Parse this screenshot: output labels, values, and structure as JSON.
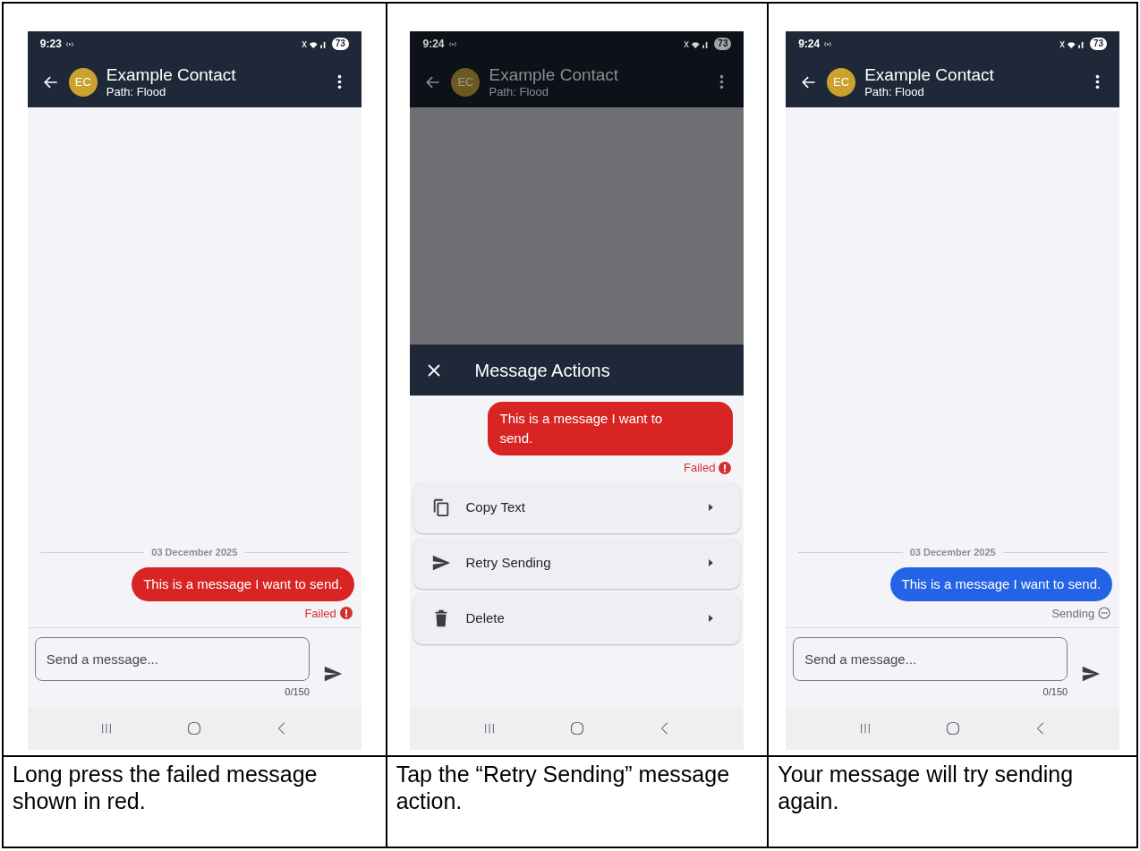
{
  "panels": [
    {
      "screen": {
        "kind": "chat",
        "dimmed": false,
        "time": "9:23",
        "battery": "73",
        "contact": {
          "initials": "EC",
          "name": "Example Contact",
          "path": "Path: Flood"
        },
        "date": "03 December 2025",
        "message": {
          "text": "This is a message I want to send.",
          "kind": "failed",
          "status_label": "Failed"
        },
        "input": {
          "placeholder": "Send a message...",
          "counter": "0/150"
        }
      },
      "caption": "Long press the failed message shown in red."
    },
    {
      "screen": {
        "kind": "actions",
        "dimmed": true,
        "time": "9:24",
        "battery": "73",
        "contact": {
          "initials": "EC",
          "name": "Example Contact",
          "path": "Path: Flood"
        },
        "sheet_title": "Message Actions",
        "message": {
          "text": "This is a message I want to send.",
          "kind": "failed",
          "status_label": "Failed"
        },
        "actions": [
          {
            "kind": "copy",
            "label": "Copy Text"
          },
          {
            "kind": "send",
            "label": "Retry Sending"
          },
          {
            "kind": "trash",
            "label": "Delete"
          }
        ]
      },
      "caption": "Tap the “Retry Sending” message action."
    },
    {
      "screen": {
        "kind": "chat",
        "dimmed": false,
        "time": "9:24",
        "battery": "73",
        "contact": {
          "initials": "EC",
          "name": "Example Contact",
          "path": "Path: Flood"
        },
        "date": "03 December 2025",
        "message": {
          "text": "This is a message I want to send.",
          "kind": "sending",
          "status_label": "Sending"
        },
        "input": {
          "placeholder": "Send a message...",
          "counter": "0/150"
        }
      },
      "caption": "Your message will try sending again."
    }
  ]
}
